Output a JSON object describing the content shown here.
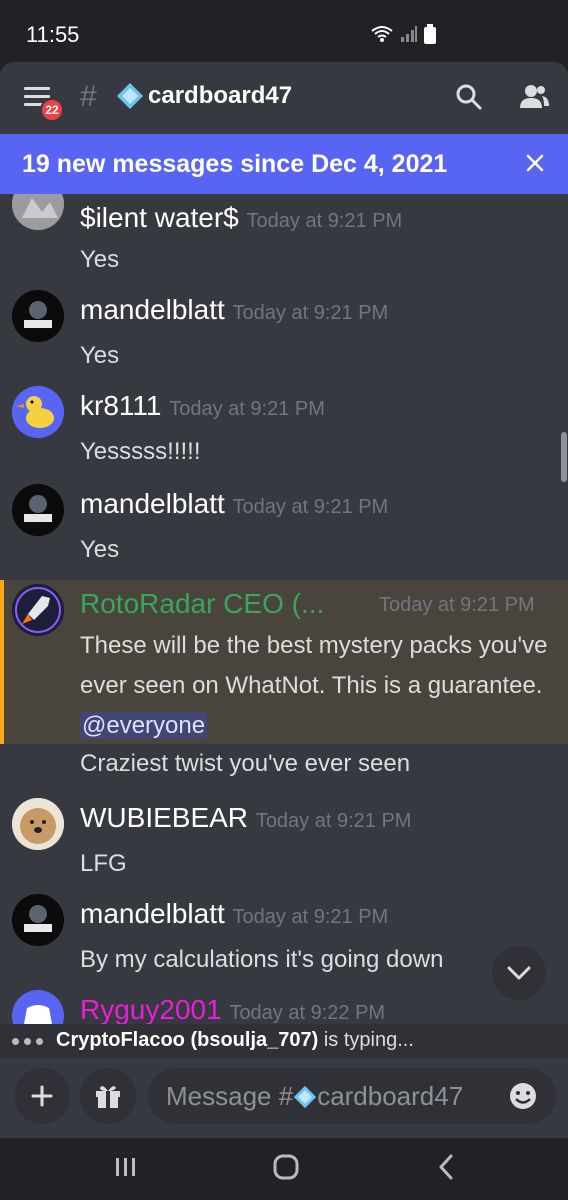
{
  "status_bar": {
    "time": "11:55"
  },
  "header": {
    "badge_count": "22",
    "channel_name": "cardboard47"
  },
  "banner": {
    "text": "19 new messages since Dec 4, 2021"
  },
  "messages": [
    {
      "author": "$ilent water$",
      "time": "Today at 9:21 PM",
      "text": "Yes"
    },
    {
      "author": "mandelblatt",
      "time": "Today at 9:21 PM",
      "text": "Yes"
    },
    {
      "author": "kr8111",
      "time": "Today at 9:21 PM",
      "text": "Yesssss!!!!!"
    },
    {
      "author": "mandelblatt",
      "time": "Today at 9:21 PM",
      "text": "Yes"
    },
    {
      "author": "RotoRadar CEO (...",
      "time": "Today at 9:21 PM",
      "text": "These will be the best mystery packs you've ever seen on WhatNot. This is a guarantee.",
      "mention": "@everyone",
      "followup": "Craziest twist you've ever seen",
      "author_color": "#3ba55d"
    },
    {
      "author": "WUBIEBEAR",
      "time": "Today at 9:21 PM",
      "text": "LFG"
    },
    {
      "author": "mandelblatt",
      "time": "Today at 9:21 PM",
      "text": "By my calculations it's going down"
    },
    {
      "author": "Ryguy2001",
      "time": "Today at 9:22 PM",
      "author_color": "#e91ed6"
    }
  ],
  "typing": {
    "user": "CryptoFlacoo (bsoulja_707)",
    "suffix": " is typing..."
  },
  "composer": {
    "placeholder_prefix": "Message #",
    "channel": "cardboard47"
  },
  "colors": {
    "blurple": "#5865f2",
    "background": "#36393f",
    "highlight_bar": "#faa81a"
  },
  "icons": [
    "menu-icon",
    "search-icon",
    "members-icon",
    "close-icon",
    "chevron-down-icon",
    "plus-icon",
    "gift-icon",
    "emoji-icon",
    "recents-icon",
    "home-icon",
    "back-icon"
  ]
}
